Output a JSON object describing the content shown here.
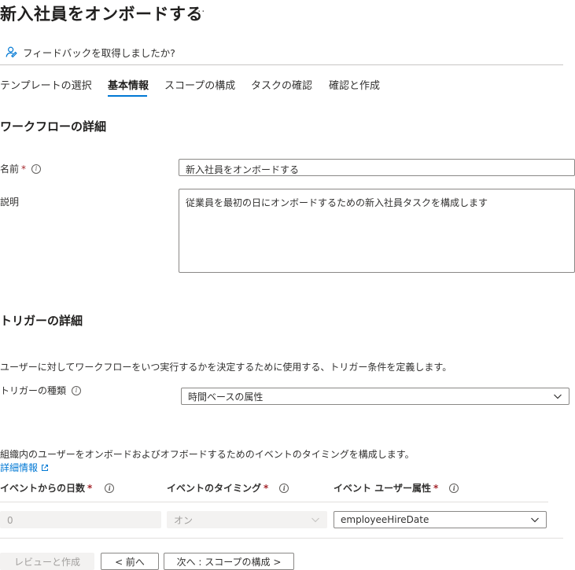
{
  "header": {
    "title": "新入社員をオンボードする",
    "more": "···"
  },
  "feedback": {
    "label": "フィードバックを取得しましたか?",
    "icon": "feedback-person-icon"
  },
  "tabs": [
    {
      "label": "テンプレートの選択",
      "active": false
    },
    {
      "label": "基本情報",
      "active": true
    },
    {
      "label": "スコープの構成",
      "active": false
    },
    {
      "label": "タスクの確認",
      "active": false
    },
    {
      "label": "確認と作成",
      "active": false
    }
  ],
  "workflow": {
    "title": "ワークフローの詳細",
    "name_label": "名前",
    "name_required": "*",
    "name_value": "新入社員をオンボードする",
    "desc_label": "説明",
    "desc_value": "従業員を最初の日にオンボードするための新入社員タスクを構成します"
  },
  "trigger": {
    "title": "トリガーの詳細",
    "description": "ユーザーに対してワークフローをいつ実行するかを決定するために使用する、トリガー条件を定義します。",
    "type_label": "トリガーの種類",
    "type_value": "時間ベースの属性"
  },
  "timing": {
    "description": "組織内のユーザーをオンボードおよびオフボードするためのイベントのタイミングを構成します。",
    "learn_more": "詳細情報",
    "days_label": "イベントからの日数",
    "days_value": "0",
    "timing_label": "イベントのタイミング",
    "timing_value": "オン",
    "attr_label": "イベント ユーザー属性",
    "attr_value": "employeeHireDate",
    "required": "*"
  },
  "footer": {
    "review_create": "レビューと作成",
    "prev": "< 前へ",
    "next": "次へ : スコープの構成 >"
  },
  "colors": {
    "accent": "#0078d4",
    "required": "#a4262c",
    "disabled_bg": "#f3f2f1"
  }
}
